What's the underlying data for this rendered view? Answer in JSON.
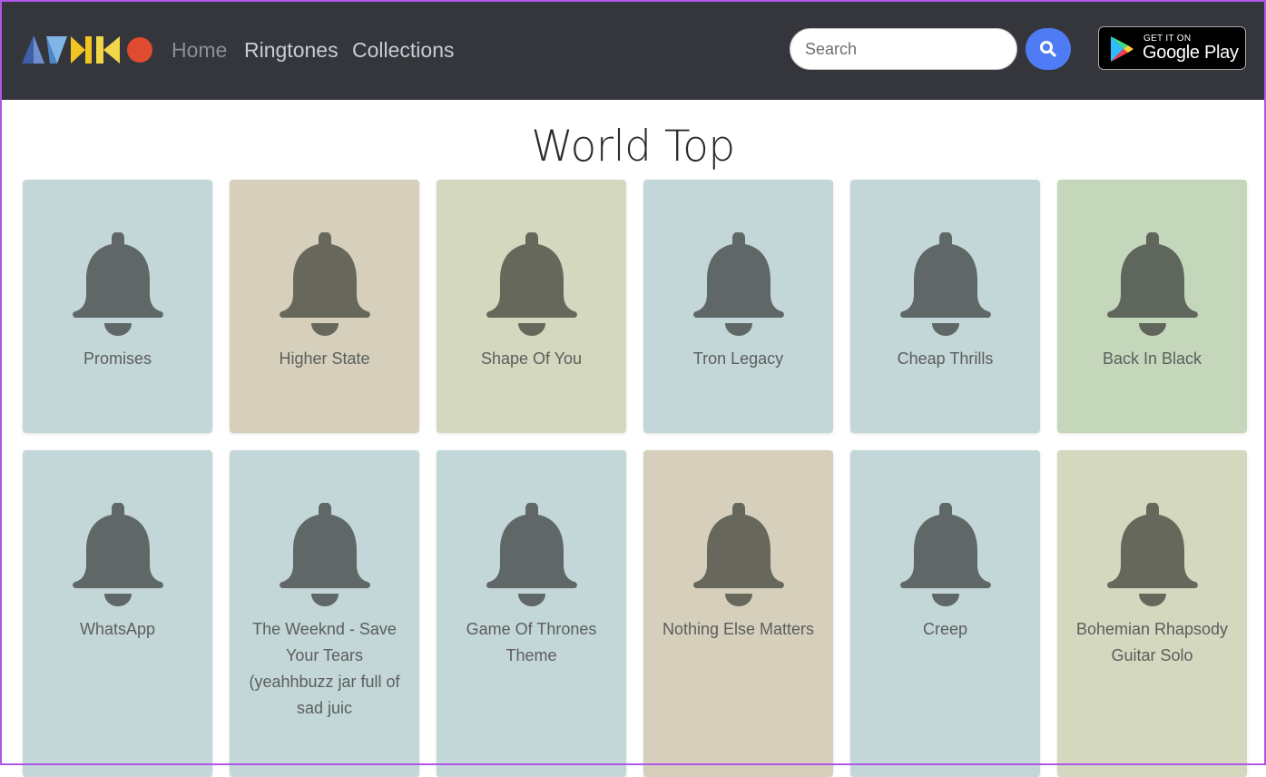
{
  "navbar": {
    "brand": "AVAKO",
    "links": [
      {
        "label": "Home",
        "active": true
      },
      {
        "label": "Ringtones",
        "active": false
      },
      {
        "label": "Collections",
        "active": false
      }
    ],
    "search": {
      "placeholder": "Search",
      "icon": "search-icon"
    },
    "store_badge": {
      "line1": "GET IT ON",
      "line2": "Google Play"
    }
  },
  "section": {
    "title": "World Top"
  },
  "ringtones": [
    {
      "title": "Promises",
      "bg": "#c3d6d8",
      "bell": "#5f6866"
    },
    {
      "title": "Higher State",
      "bg": "#d5cfbc",
      "bell": "#68675c"
    },
    {
      "title": "Shape Of You",
      "bg": "#d3d8bf",
      "bell": "#67685c"
    },
    {
      "title": "Tron Legacy",
      "bg": "#c3d6d8",
      "bell": "#5f6866"
    },
    {
      "title": "Cheap Thrills",
      "bg": "#c3d6d8",
      "bell": "#5f6866"
    },
    {
      "title": "Back In Black",
      "bg": "#c4d7bb",
      "bell": "#5f675c"
    },
    {
      "title": "WhatsApp",
      "bg": "#c3d6d8",
      "bell": "#5f6866"
    },
    {
      "title": "The Weeknd - Save Your Tears (yeahhbuzz jar full of sad juic",
      "bg": "#c3d6d8",
      "bell": "#5f6866"
    },
    {
      "title": "Game Of Thrones Theme",
      "bg": "#c3d6d8",
      "bell": "#5f6866"
    },
    {
      "title": "Nothing Else Matters",
      "bg": "#d5cfbc",
      "bell": "#68675c"
    },
    {
      "title": "Creep",
      "bg": "#c3d6d8",
      "bell": "#5f6866"
    },
    {
      "title": "Bohemian Rhapsody Guitar Solo",
      "bg": "#d3d8bf",
      "bell": "#67685c"
    }
  ]
}
